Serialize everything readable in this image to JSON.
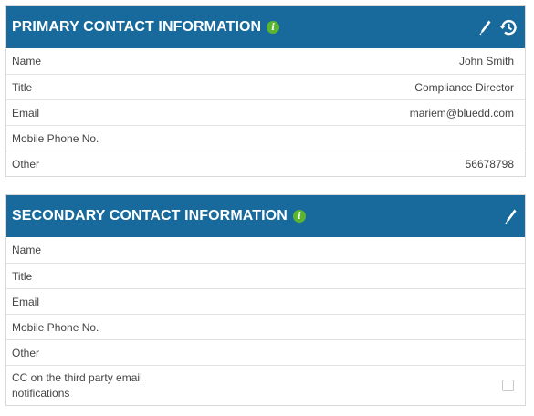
{
  "primary": {
    "title": "PRIMARY CONTACT INFORMATION",
    "info_icon": "info-icon",
    "rows": [
      {
        "label": "Name",
        "value": "John Smith"
      },
      {
        "label": "Title",
        "value": "Compliance Director"
      },
      {
        "label": "Email",
        "value": "mariem@bluedd.com"
      },
      {
        "label": "Mobile Phone No.",
        "value": ""
      },
      {
        "label": "Other",
        "value": "56678798"
      }
    ]
  },
  "secondary": {
    "title": "SECONDARY CONTACT INFORMATION",
    "info_icon": "info-icon",
    "rows": [
      {
        "label": "Name",
        "value": ""
      },
      {
        "label": "Title",
        "value": ""
      },
      {
        "label": "Email",
        "value": ""
      },
      {
        "label": "Mobile Phone No.",
        "value": ""
      },
      {
        "label": "Other",
        "value": ""
      }
    ],
    "cc_label": "CC on the third party email notifications",
    "cc_checked": false
  },
  "colors": {
    "header_bg": "#186a9c",
    "info_green": "#5cb531"
  }
}
